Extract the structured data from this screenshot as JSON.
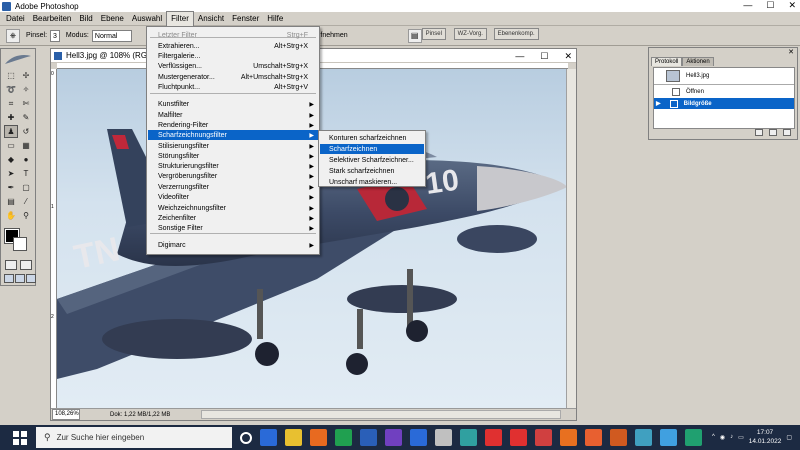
{
  "app": {
    "title": "Adobe Photoshop"
  },
  "menubar": [
    "Datei",
    "Bearbeiten",
    "Bild",
    "Ebene",
    "Auswahl",
    "Filter",
    "Ansicht",
    "Fenster",
    "Hilfe"
  ],
  "options": {
    "pinsel_label": "Pinsel:",
    "pinsel_value": "3",
    "modus_label": "Modus:",
    "modus_value": "Normal",
    "alle_ebenen": "Alle Ebenen aufnehmen",
    "wells": [
      "Pinsel",
      "WZ-Vorg.",
      "Ebenenkomp."
    ]
  },
  "document": {
    "title": "Hell3.jpg @ 108% (RGB/8)",
    "zoom": "108,26%",
    "doc_info": "Dok: 1,22 MB/1,22 MB",
    "ruler_marks": [
      "0",
      "1",
      "2"
    ]
  },
  "filter_menu": {
    "items": [
      {
        "label": "Letzter Filter",
        "shortcut": "Strg+F",
        "disabled": true
      },
      {
        "label": "Extrahieren...",
        "shortcut": "Alt+Strg+X"
      },
      {
        "label": "Filtergalerie..."
      },
      {
        "label": "Verflüssigen...",
        "shortcut": "Umschalt+Strg+X"
      },
      {
        "label": "Mustergenerator...",
        "shortcut": "Alt+Umschalt+Strg+X"
      },
      {
        "label": "Fluchtpunkt...",
        "shortcut": "Alt+Strg+V"
      },
      {
        "label": "Kunstfilter",
        "submenu": true
      },
      {
        "label": "Malfilter",
        "submenu": true
      },
      {
        "label": "Rendering-Filter",
        "submenu": true
      },
      {
        "label": "Scharfzeichnungsfilter",
        "submenu": true,
        "highlight": true
      },
      {
        "label": "Stilisierungsfilter",
        "submenu": true
      },
      {
        "label": "Störungsfilter",
        "submenu": true
      },
      {
        "label": "Strukturierungsfilter",
        "submenu": true
      },
      {
        "label": "Vergröberungsfilter",
        "submenu": true
      },
      {
        "label": "Verzerrungsfilter",
        "submenu": true
      },
      {
        "label": "Videofilter",
        "submenu": true
      },
      {
        "label": "Weichzeichnungsfilter",
        "submenu": true
      },
      {
        "label": "Zeichenfilter",
        "submenu": true
      },
      {
        "label": "Sonstige Filter",
        "submenu": true
      },
      {
        "label": "Digimarc",
        "submenu": true
      }
    ]
  },
  "sharpen_submenu": {
    "items": [
      {
        "label": "Konturen scharfzeichnen"
      },
      {
        "label": "Scharfzeichnen",
        "highlight": true
      },
      {
        "label": "Selektiver Scharfzeichner..."
      },
      {
        "label": "Stark scharfzeichnen"
      },
      {
        "label": "Unscharf maskieren..."
      }
    ]
  },
  "history": {
    "tabs": [
      "Protokoll",
      "Aktionen"
    ],
    "snapshot": "Hell3.jpg",
    "steps": [
      "Öffnen",
      "Bildgröße"
    ]
  },
  "taskbar": {
    "search_placeholder": "Zur Suche hier eingeben",
    "time": "17:07",
    "date": "14.01.2022",
    "icons": [
      "task-view-icon",
      "photoshop-icon",
      "file-explorer-icon",
      "firefox-icon",
      "excel-icon",
      "word-icon",
      "app-icon",
      "photoshop2-icon",
      "app2-icon",
      "app3-icon",
      "pdf-icon",
      "pdf2-icon",
      "app4-icon",
      "app5-icon",
      "app6-icon",
      "app7-icon",
      "app8-icon",
      "vpn-icon",
      "app9-icon"
    ]
  },
  "colors": {
    "highlight": "#0a64c8",
    "taskbar": "#1c2a42",
    "chrome": "#d4d0c8"
  }
}
